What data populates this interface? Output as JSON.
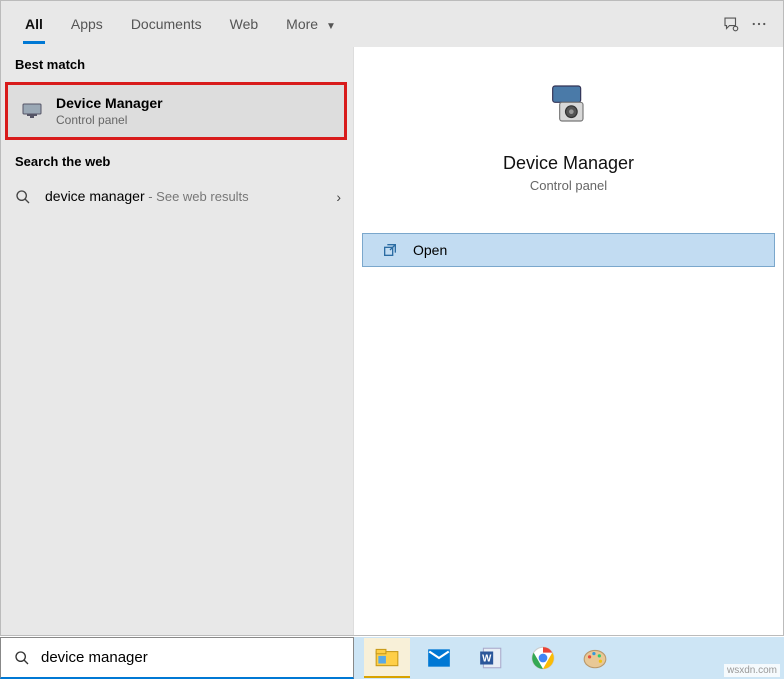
{
  "tabs": {
    "all": "All",
    "apps": "Apps",
    "documents": "Documents",
    "web": "Web",
    "more": "More"
  },
  "sections": {
    "best_match": "Best match",
    "search_web": "Search the web"
  },
  "result": {
    "title": "Device Manager",
    "subtitle": "Control panel"
  },
  "web_result": {
    "query": "device manager",
    "suffix": " - See web results"
  },
  "preview": {
    "title": "Device Manager",
    "subtitle": "Control panel"
  },
  "actions": {
    "open": "Open"
  },
  "search": {
    "value": "device manager"
  },
  "watermark": "wsxdn.com",
  "taskbar": {
    "apps": [
      "explorer",
      "mail",
      "word",
      "chrome",
      "paint"
    ]
  }
}
